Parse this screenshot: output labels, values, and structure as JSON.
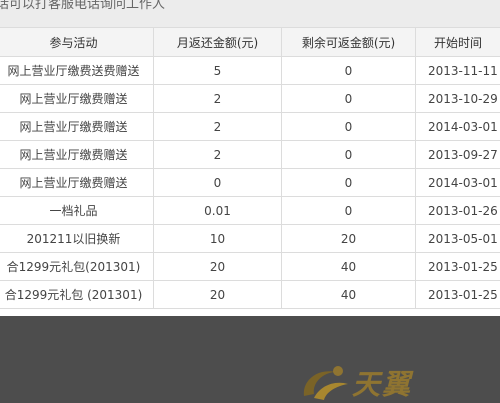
{
  "top_note": "话可以打客服电话询问工作人",
  "table": {
    "headers": [
      "参与活动",
      "月返还金额(元)",
      "剩余可返金额(元)",
      "开始时间"
    ],
    "rows": [
      [
        "网上营业厅缴费送费赠送",
        "5",
        "0",
        "2013-11-11"
      ],
      [
        "网上营业厅缴费赠送",
        "2",
        "0",
        "2013-10-29"
      ],
      [
        "网上营业厅缴费赠送",
        "2",
        "0",
        "2014-03-01"
      ],
      [
        "网上营业厅缴费赠送",
        "2",
        "0",
        "2013-09-27"
      ],
      [
        "网上营业厅缴费赠送",
        "0",
        "0",
        "2014-03-01"
      ],
      [
        "一档礼品",
        "0.01",
        "0",
        "2013-01-26"
      ],
      [
        "201211以旧换新",
        "10",
        "20",
        "2013-05-01"
      ],
      [
        "合1299元礼包(201301)",
        "20",
        "40",
        "2013-01-25"
      ],
      [
        "合1299元礼包 (201301)",
        "20",
        "40",
        "2013-01-25"
      ]
    ]
  },
  "footer": {
    "logo_text": "天翼",
    "logo_color": "#8f7431",
    "logo_icon": "swirl-logo-icon"
  }
}
